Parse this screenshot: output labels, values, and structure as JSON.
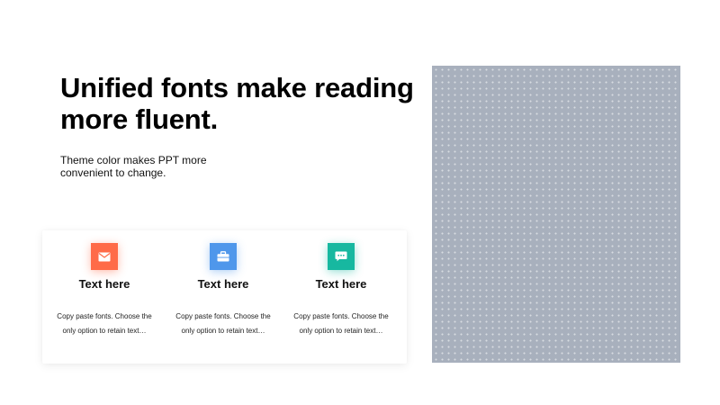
{
  "slide": {
    "headline": "Unified fonts make reading more fluent.",
    "subtext": "Theme  color makes PPT more convenient to change."
  },
  "features": [
    {
      "title": "Text here",
      "description": "Copy paste fonts. Choose the only option to retain text…",
      "icon": "envelope-icon",
      "color": "#ff6b48",
      "glow": "#ffb8a5"
    },
    {
      "title": "Text here",
      "description": "Copy paste fonts. Choose the only option to retain text…",
      "icon": "briefcase-icon",
      "color": "#4f97eb",
      "glow": "#b4d3f8"
    },
    {
      "title": "Text here",
      "description": "Copy paste fonts. Choose the only option to retain text…",
      "icon": "chat-bubble-icon",
      "color": "#17b8a0",
      "glow": "#a8eee1"
    }
  ],
  "image": {
    "color": "#a8b0bd"
  }
}
